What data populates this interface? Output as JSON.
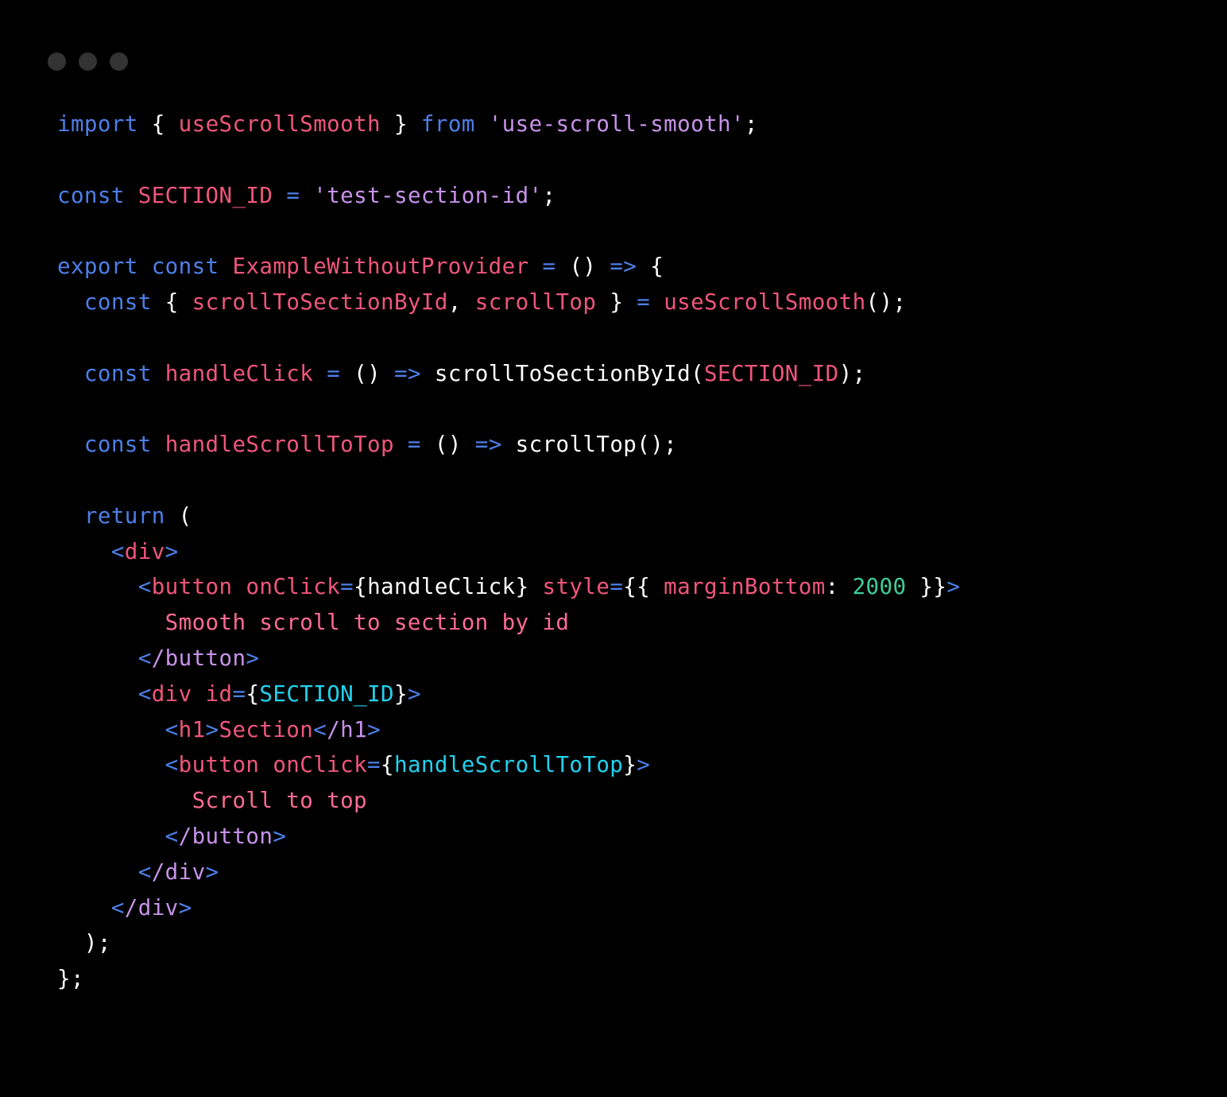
{
  "window": {
    "dots": [
      {
        "name": "close-dot",
        "color": "#333333"
      },
      {
        "name": "minimize-dot",
        "color": "#333333"
      },
      {
        "name": "maximize-dot",
        "color": "#333333"
      }
    ]
  },
  "theme": {
    "background": "#000000",
    "keyword": "#4d7fe8",
    "operator": "#4d7fe8",
    "punctuation": "#ffffff",
    "identifier": "#f0567a",
    "string": "#c792ea",
    "function_call": "#ffffff",
    "jsx_tag_open": "#f0567a",
    "jsx_tag_close": "#c792ea",
    "jsx_bracket": "#4d7fe8",
    "jsx_attribute": "#f0567a",
    "jsx_expression": "#22d3ee",
    "number": "#3ecf9a",
    "jsx_text": "#ff6b92"
  },
  "code": {
    "language": "jsx",
    "raw": "import { useScrollSmooth } from 'use-scroll-smooth';\n\nconst SECTION_ID = 'test-section-id';\n\nexport const ExampleWithoutProvider = () => {\n  const { scrollToSectionById, scrollTop } = useScrollSmooth();\n\n  const handleClick = () => scrollToSectionById(SECTION_ID);\n\n  const handleScrollToTop = () => scrollTop();\n\n  return (\n    <div>\n      <button onClick={handleClick} style={{ marginBottom: 2000 }}>\n        Smooth scroll to section by id\n      </button>\n      <div id={SECTION_ID}>\n        <h1>Section</h1>\n        <button onClick={handleScrollToTop}>\n          Scroll to top\n        </button>\n      </div>\n    </div>\n  );\n};",
    "lines": [
      {
        "n": 1,
        "text": "import { useScrollSmooth } from 'use-scroll-smooth';",
        "tokens": [
          {
            "v": "import",
            "c": "t-keyword"
          },
          {
            "v": " ",
            "c": "t-punct"
          },
          {
            "v": "{",
            "c": "t-punct"
          },
          {
            "v": " ",
            "c": "t-punct"
          },
          {
            "v": "useScrollSmooth",
            "c": "t-ident"
          },
          {
            "v": " ",
            "c": "t-punct"
          },
          {
            "v": "}",
            "c": "t-punct"
          },
          {
            "v": " ",
            "c": "t-punct"
          },
          {
            "v": "from",
            "c": "t-keyword"
          },
          {
            "v": " ",
            "c": "t-punct"
          },
          {
            "v": "'use-scroll-smooth'",
            "c": "t-string"
          },
          {
            "v": ";",
            "c": "t-punct"
          }
        ]
      },
      {
        "n": 2,
        "text": "",
        "tokens": []
      },
      {
        "n": 3,
        "text": "const SECTION_ID = 'test-section-id';",
        "tokens": [
          {
            "v": "const",
            "c": "t-keyword"
          },
          {
            "v": " ",
            "c": "t-punct"
          },
          {
            "v": "SECTION_ID",
            "c": "t-ident"
          },
          {
            "v": " ",
            "c": "t-punct"
          },
          {
            "v": "=",
            "c": "t-operator"
          },
          {
            "v": " ",
            "c": "t-punct"
          },
          {
            "v": "'test-section-id'",
            "c": "t-string"
          },
          {
            "v": ";",
            "c": "t-punct"
          }
        ]
      },
      {
        "n": 4,
        "text": "",
        "tokens": []
      },
      {
        "n": 5,
        "text": "export const ExampleWithoutProvider = () => {",
        "tokens": [
          {
            "v": "export",
            "c": "t-keyword"
          },
          {
            "v": " ",
            "c": "t-punct"
          },
          {
            "v": "const",
            "c": "t-keyword"
          },
          {
            "v": " ",
            "c": "t-punct"
          },
          {
            "v": "ExampleWithoutProvider",
            "c": "t-ident"
          },
          {
            "v": " ",
            "c": "t-punct"
          },
          {
            "v": "=",
            "c": "t-operator"
          },
          {
            "v": " ",
            "c": "t-punct"
          },
          {
            "v": "()",
            "c": "t-punct"
          },
          {
            "v": " ",
            "c": "t-punct"
          },
          {
            "v": "=>",
            "c": "t-operator"
          },
          {
            "v": " ",
            "c": "t-punct"
          },
          {
            "v": "{",
            "c": "t-punct"
          }
        ]
      },
      {
        "n": 6,
        "text": "  const { scrollToSectionById, scrollTop } = useScrollSmooth();",
        "tokens": [
          {
            "v": "  ",
            "c": "t-punct"
          },
          {
            "v": "const",
            "c": "t-keyword"
          },
          {
            "v": " ",
            "c": "t-punct"
          },
          {
            "v": "{",
            "c": "t-punct"
          },
          {
            "v": " ",
            "c": "t-punct"
          },
          {
            "v": "scrollToSectionById",
            "c": "t-ident"
          },
          {
            "v": ",",
            "c": "t-punct"
          },
          {
            "v": " ",
            "c": "t-punct"
          },
          {
            "v": "scrollTop",
            "c": "t-ident"
          },
          {
            "v": " ",
            "c": "t-punct"
          },
          {
            "v": "}",
            "c": "t-punct"
          },
          {
            "v": " ",
            "c": "t-punct"
          },
          {
            "v": "=",
            "c": "t-operator"
          },
          {
            "v": " ",
            "c": "t-punct"
          },
          {
            "v": "useScrollSmooth",
            "c": "t-ident"
          },
          {
            "v": "();",
            "c": "t-punct"
          }
        ]
      },
      {
        "n": 7,
        "text": "",
        "tokens": []
      },
      {
        "n": 8,
        "text": "  const handleClick = () => scrollToSectionById(SECTION_ID);",
        "tokens": [
          {
            "v": "  ",
            "c": "t-punct"
          },
          {
            "v": "const",
            "c": "t-keyword"
          },
          {
            "v": " ",
            "c": "t-punct"
          },
          {
            "v": "handleClick",
            "c": "t-ident"
          },
          {
            "v": " ",
            "c": "t-punct"
          },
          {
            "v": "=",
            "c": "t-operator"
          },
          {
            "v": " ",
            "c": "t-punct"
          },
          {
            "v": "()",
            "c": "t-punct"
          },
          {
            "v": " ",
            "c": "t-punct"
          },
          {
            "v": "=>",
            "c": "t-operator"
          },
          {
            "v": " ",
            "c": "t-punct"
          },
          {
            "v": "scrollToSectionById",
            "c": "t-fn"
          },
          {
            "v": "(",
            "c": "t-punct"
          },
          {
            "v": "SECTION_ID",
            "c": "t-ident"
          },
          {
            "v": ");",
            "c": "t-punct"
          }
        ]
      },
      {
        "n": 9,
        "text": "",
        "tokens": []
      },
      {
        "n": 10,
        "text": "  const handleScrollToTop = () => scrollTop();",
        "tokens": [
          {
            "v": "  ",
            "c": "t-punct"
          },
          {
            "v": "const",
            "c": "t-keyword"
          },
          {
            "v": " ",
            "c": "t-punct"
          },
          {
            "v": "handleScrollToTop",
            "c": "t-ident"
          },
          {
            "v": " ",
            "c": "t-punct"
          },
          {
            "v": "=",
            "c": "t-operator"
          },
          {
            "v": " ",
            "c": "t-punct"
          },
          {
            "v": "()",
            "c": "t-punct"
          },
          {
            "v": " ",
            "c": "t-punct"
          },
          {
            "v": "=>",
            "c": "t-operator"
          },
          {
            "v": " ",
            "c": "t-punct"
          },
          {
            "v": "scrollTop",
            "c": "t-fn"
          },
          {
            "v": "();",
            "c": "t-punct"
          }
        ]
      },
      {
        "n": 11,
        "text": "",
        "tokens": []
      },
      {
        "n": 12,
        "text": "  return (",
        "tokens": [
          {
            "v": "  ",
            "c": "t-punct"
          },
          {
            "v": "return",
            "c": "t-keyword"
          },
          {
            "v": " ",
            "c": "t-punct"
          },
          {
            "v": "(",
            "c": "t-punct"
          }
        ]
      },
      {
        "n": 13,
        "text": "    <div>",
        "tokens": [
          {
            "v": "    ",
            "c": "t-punct"
          },
          {
            "v": "<",
            "c": "t-bracket"
          },
          {
            "v": "div",
            "c": "t-tag"
          },
          {
            "v": ">",
            "c": "t-bracket"
          }
        ]
      },
      {
        "n": 14,
        "text": "      <button onClick={handleClick} style={{ marginBottom: 2000 }}>",
        "tokens": [
          {
            "v": "      ",
            "c": "t-punct"
          },
          {
            "v": "<",
            "c": "t-bracket"
          },
          {
            "v": "button",
            "c": "t-tag"
          },
          {
            "v": " ",
            "c": "t-punct"
          },
          {
            "v": "onClick",
            "c": "t-attr"
          },
          {
            "v": "=",
            "c": "t-operator"
          },
          {
            "v": "{handleClick}",
            "c": "t-exprplain"
          },
          {
            "v": " ",
            "c": "t-punct"
          },
          {
            "v": "style",
            "c": "t-attr"
          },
          {
            "v": "=",
            "c": "t-operator"
          },
          {
            "v": "{{",
            "c": "t-punct"
          },
          {
            "v": " ",
            "c": "t-punct"
          },
          {
            "v": "marginBottom",
            "c": "t-prop"
          },
          {
            "v": ":",
            "c": "t-punct"
          },
          {
            "v": " ",
            "c": "t-punct"
          },
          {
            "v": "2000",
            "c": "t-number"
          },
          {
            "v": " ",
            "c": "t-punct"
          },
          {
            "v": "}}",
            "c": "t-punct"
          },
          {
            "v": ">",
            "c": "t-bracket"
          }
        ]
      },
      {
        "n": 15,
        "text": "        Smooth scroll to section by id",
        "tokens": [
          {
            "v": "        ",
            "c": "t-punct"
          },
          {
            "v": "Smooth scroll to section by id",
            "c": "t-text"
          }
        ]
      },
      {
        "n": 16,
        "text": "      </button>",
        "tokens": [
          {
            "v": "      ",
            "c": "t-punct"
          },
          {
            "v": "<",
            "c": "t-bracket"
          },
          {
            "v": "/button",
            "c": "t-tagclose"
          },
          {
            "v": ">",
            "c": "t-bracket"
          }
        ]
      },
      {
        "n": 17,
        "text": "      <div id={SECTION_ID}>",
        "tokens": [
          {
            "v": "      ",
            "c": "t-punct"
          },
          {
            "v": "<",
            "c": "t-bracket"
          },
          {
            "v": "div",
            "c": "t-tag"
          },
          {
            "v": " ",
            "c": "t-punct"
          },
          {
            "v": "id",
            "c": "t-attr"
          },
          {
            "v": "=",
            "c": "t-operator"
          },
          {
            "v": "{",
            "c": "t-punct"
          },
          {
            "v": "SECTION_ID",
            "c": "t-expr"
          },
          {
            "v": "}",
            "c": "t-punct"
          },
          {
            "v": ">",
            "c": "t-bracket"
          }
        ]
      },
      {
        "n": 18,
        "text": "        <h1>Section</h1>",
        "tokens": [
          {
            "v": "        ",
            "c": "t-punct"
          },
          {
            "v": "<",
            "c": "t-bracket"
          },
          {
            "v": "h1",
            "c": "t-tag"
          },
          {
            "v": ">",
            "c": "t-bracket"
          },
          {
            "v": "Section",
            "c": "t-tag"
          },
          {
            "v": "<",
            "c": "t-bracket"
          },
          {
            "v": "/h1",
            "c": "t-tagclose"
          },
          {
            "v": ">",
            "c": "t-bracket"
          }
        ]
      },
      {
        "n": 19,
        "text": "        <button onClick={handleScrollToTop}>",
        "tokens": [
          {
            "v": "        ",
            "c": "t-punct"
          },
          {
            "v": "<",
            "c": "t-bracket"
          },
          {
            "v": "button",
            "c": "t-tag"
          },
          {
            "v": " ",
            "c": "t-punct"
          },
          {
            "v": "onClick",
            "c": "t-attr"
          },
          {
            "v": "=",
            "c": "t-operator"
          },
          {
            "v": "{",
            "c": "t-punct"
          },
          {
            "v": "handleScrollToTop",
            "c": "t-expr"
          },
          {
            "v": "}",
            "c": "t-punct"
          },
          {
            "v": ">",
            "c": "t-bracket"
          }
        ]
      },
      {
        "n": 20,
        "text": "          Scroll to top",
        "tokens": [
          {
            "v": "          ",
            "c": "t-punct"
          },
          {
            "v": "Scroll to top",
            "c": "t-text"
          }
        ]
      },
      {
        "n": 21,
        "text": "        </button>",
        "tokens": [
          {
            "v": "        ",
            "c": "t-punct"
          },
          {
            "v": "<",
            "c": "t-bracket"
          },
          {
            "v": "/button",
            "c": "t-tagclose"
          },
          {
            "v": ">",
            "c": "t-bracket"
          }
        ]
      },
      {
        "n": 22,
        "text": "      </div>",
        "tokens": [
          {
            "v": "      ",
            "c": "t-punct"
          },
          {
            "v": "<",
            "c": "t-bracket"
          },
          {
            "v": "/div",
            "c": "t-tagclose"
          },
          {
            "v": ">",
            "c": "t-bracket"
          }
        ]
      },
      {
        "n": 23,
        "text": "    </div>",
        "tokens": [
          {
            "v": "    ",
            "c": "t-punct"
          },
          {
            "v": "<",
            "c": "t-bracket"
          },
          {
            "v": "/div",
            "c": "t-tagclose"
          },
          {
            "v": ">",
            "c": "t-bracket"
          }
        ]
      },
      {
        "n": 24,
        "text": "  );",
        "tokens": [
          {
            "v": "  ",
            "c": "t-punct"
          },
          {
            "v": ");",
            "c": "t-punct"
          }
        ]
      },
      {
        "n": 25,
        "text": "};",
        "tokens": [
          {
            "v": "};",
            "c": "t-punct"
          }
        ]
      }
    ]
  }
}
